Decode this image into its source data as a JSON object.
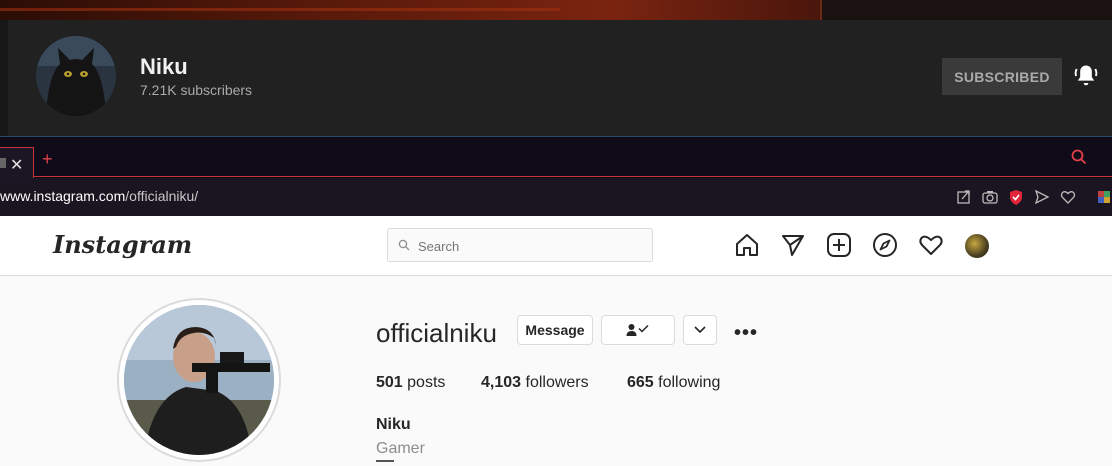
{
  "youtube": {
    "channel_name": "Niku",
    "subscribers": "7.21K subscribers",
    "subscribe_label": "SUBSCRIBED"
  },
  "browser": {
    "close_glyph": "✕",
    "new_tab_glyph": "+",
    "url_domain": "www.instagram.com",
    "url_path": "/officialniku/",
    "accent": "#c8303a"
  },
  "instagram": {
    "logo_text": "Instagram",
    "search_placeholder": "Search",
    "username": "officialniku",
    "message_label": "Message",
    "more_glyph": "•••",
    "stats": {
      "posts_count": "501",
      "posts_label": "posts",
      "followers_count": "4,103",
      "followers_label": "followers",
      "following_count": "665",
      "following_label": "following"
    },
    "full_name": "Niku",
    "category": "Gamer"
  }
}
